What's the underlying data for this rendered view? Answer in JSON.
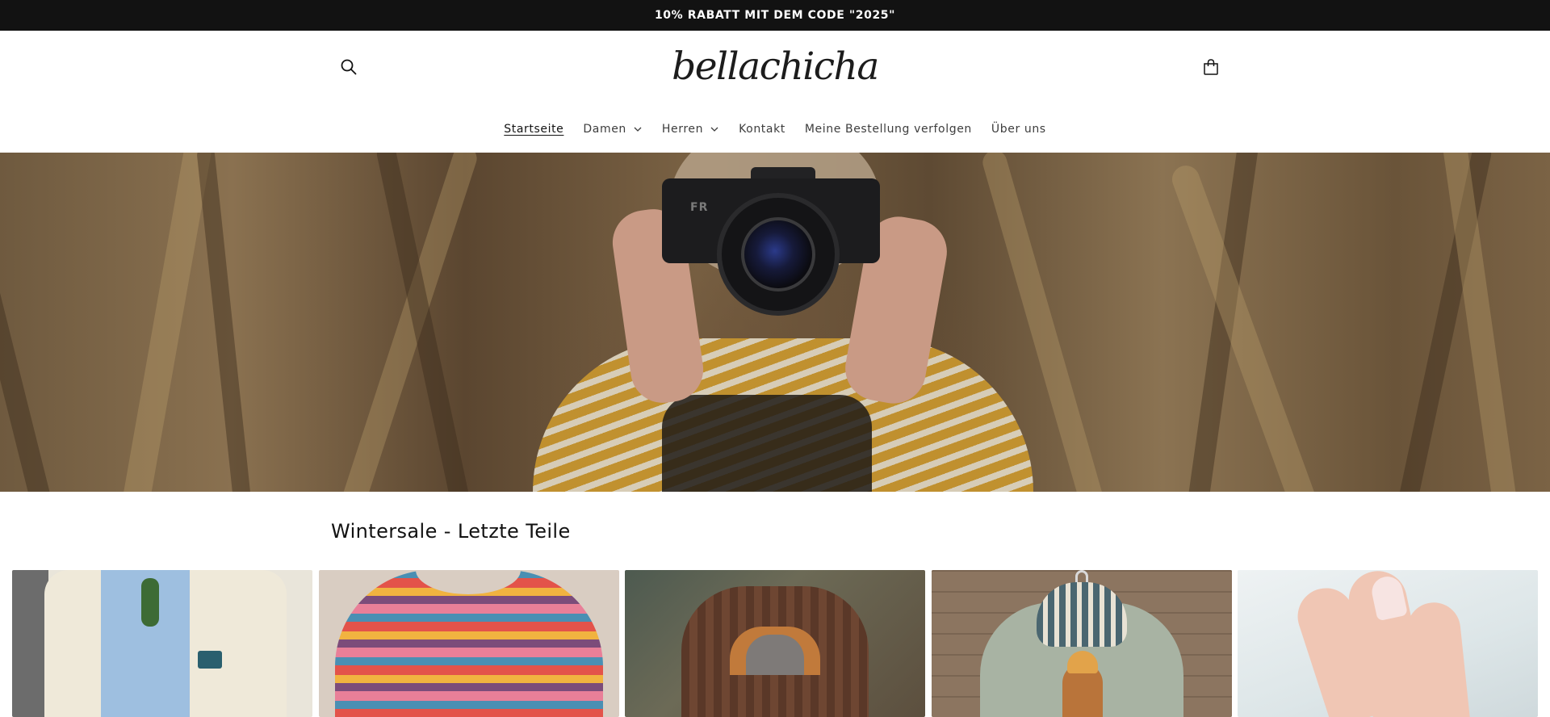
{
  "announcement": {
    "text": "10% RABATT MIT DEM CODE \"2025\""
  },
  "header": {
    "logo": "bellachicha",
    "search_icon": "search-icon",
    "cart_icon": "cart-icon"
  },
  "nav": {
    "items": [
      {
        "label": "Startseite",
        "active": true,
        "has_dropdown": false
      },
      {
        "label": "Damen",
        "active": false,
        "has_dropdown": true
      },
      {
        "label": "Herren",
        "active": false,
        "has_dropdown": true
      },
      {
        "label": "Kontakt",
        "active": false,
        "has_dropdown": false
      },
      {
        "label": "Meine Bestellung verfolgen",
        "active": false,
        "has_dropdown": false
      },
      {
        "label": "Über uns",
        "active": false,
        "has_dropdown": false
      }
    ]
  },
  "hero": {
    "brand_mark": "FR"
  },
  "collection": {
    "title": "Wintersale - Letzte Teile"
  },
  "colors": {
    "announcement_bg": "#121212",
    "text": "#121212",
    "background": "#ffffff"
  }
}
